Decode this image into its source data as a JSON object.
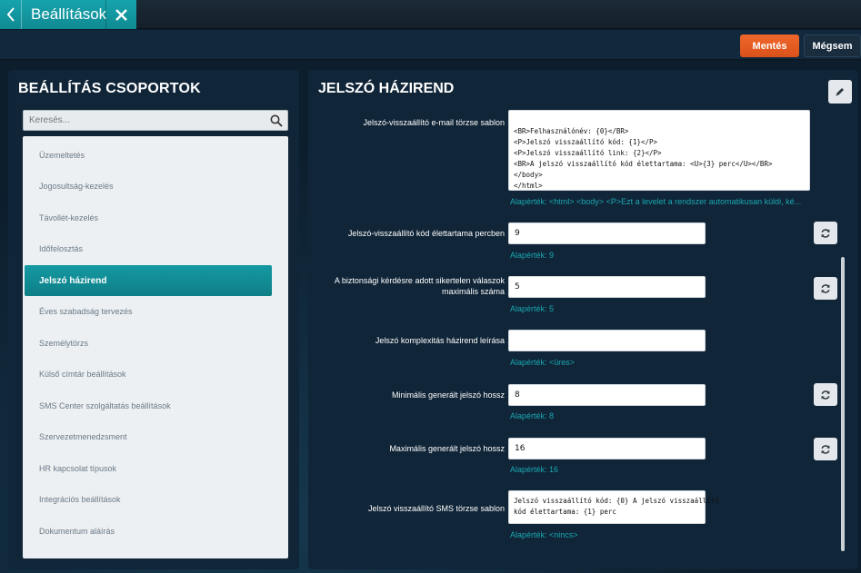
{
  "app": {
    "title": "Beállítások"
  },
  "toolbar": {
    "save_label": "Mentés",
    "cancel_label": "Mégsem"
  },
  "groups_panel": {
    "title": "BEÁLLÍTÁS CSOPORTOK",
    "search_placeholder": "Keresés...",
    "items": [
      {
        "label": "Üzemeltetés",
        "active": false
      },
      {
        "label": "Jogosultság-kezelés",
        "active": false
      },
      {
        "label": "Távollét-kezelés",
        "active": false
      },
      {
        "label": "Időfelosztás",
        "active": false
      },
      {
        "label": "Jelszó házirend",
        "active": true
      },
      {
        "label": "Éves szabadság tervezés",
        "active": false
      },
      {
        "label": "Személytörzs",
        "active": false
      },
      {
        "label": "Külső címtár beállítások",
        "active": false
      },
      {
        "label": "SMS Center szolgáltatás beállítások",
        "active": false
      },
      {
        "label": "Szervezetmenedzsment",
        "active": false
      },
      {
        "label": "HR kapcsolat típusok",
        "active": false
      },
      {
        "label": "Integrációs beállítások",
        "active": false
      },
      {
        "label": "Dokumentum aláírás",
        "active": false
      }
    ]
  },
  "settings_panel": {
    "title": "JELSZÓ HÁZIREND",
    "fields": {
      "email_template": {
        "label": "Jelszó-visszaállító e-mail törzse sablon",
        "value": "<BR>Felhasználónév: {0}</BR>\n<P>Jelszó visszaállító kód: {1}</P>\n<P>Jelszó visszaállító link: {2}</P>\n<BR>A jelszó visszaállító kód élettartama: <U>{3} perc</U></BR>\n</body>\n</html>",
        "default": "Alapérték: <html> <body> <P>Ezt a levelet a rendszer automatikusan küldi, ké..."
      },
      "code_lifetime": {
        "label": "Jelszó-visszaállító kód élettartama percben",
        "value": "9",
        "default": "Alapérték: 9"
      },
      "max_failed_answers": {
        "label": "A biztonsági kérdésre adott sikertelen válaszok maximális száma",
        "value": "5",
        "default": "Alapérték: 5"
      },
      "complexity_description": {
        "label": "Jelszó komplexitás házirend leírása",
        "value": "",
        "default": "Alapérték: <üres>"
      },
      "min_length": {
        "label": "Minimális generált jelszó hossz",
        "value": "8",
        "default": "Alapérték: 8"
      },
      "max_length": {
        "label": "Maximális generált jelszó hossz",
        "value": "16",
        "default": "Alapérték: 16"
      },
      "sms_template": {
        "label": "Jelszó visszaállító SMS törzse sablon",
        "value": "Jelszó visszaállító kód: {0} A jelszó visszaállító\nkód élettartama: {1} perc",
        "default": "Alapérték: <nincs>"
      }
    }
  },
  "colors": {
    "accent_teal": "#1599a2",
    "save_orange": "#e85d22",
    "panel_bg": "#102538",
    "default_text": "#1aa7b1"
  },
  "icons": {
    "back": "chevron-left-icon",
    "close": "close-icon",
    "search": "search-icon",
    "edit": "pencil-icon",
    "reset": "refresh-icon"
  }
}
